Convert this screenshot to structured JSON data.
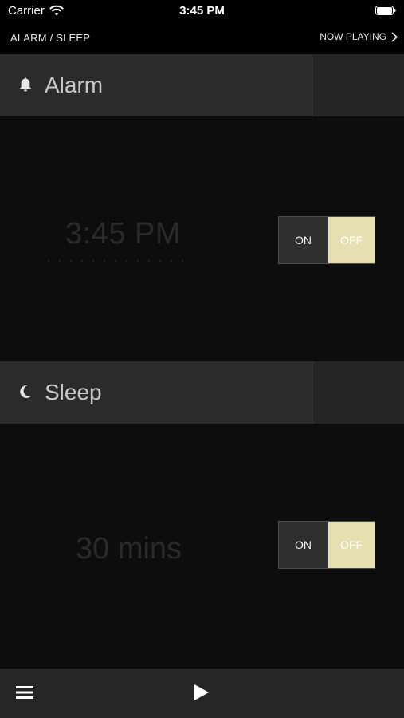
{
  "status": {
    "carrier": "Carrier",
    "time": "3:45 PM"
  },
  "nav": {
    "title": "ALARM / SLEEP",
    "now_playing": "NOW PLAYING"
  },
  "alarm": {
    "header": "Alarm",
    "icon": "bell-icon",
    "time": "3:45 PM",
    "toggle": {
      "on_label": "ON",
      "off_label": "OFF",
      "selected": "OFF"
    }
  },
  "sleep": {
    "header": "Sleep",
    "icon": "moon-icon",
    "duration": "30 mins",
    "toggle": {
      "on_label": "ON",
      "off_label": "OFF",
      "selected": "OFF"
    }
  },
  "toolbar": {
    "menu_icon": "menu-icon",
    "play_icon": "play-icon"
  },
  "colors": {
    "background": "#0c0c0c",
    "header": "#2b2b2b",
    "toggle_on": "#2e2e2e",
    "toggle_off_selected": "#e5dfb1",
    "bottom_bar": "#262626"
  }
}
